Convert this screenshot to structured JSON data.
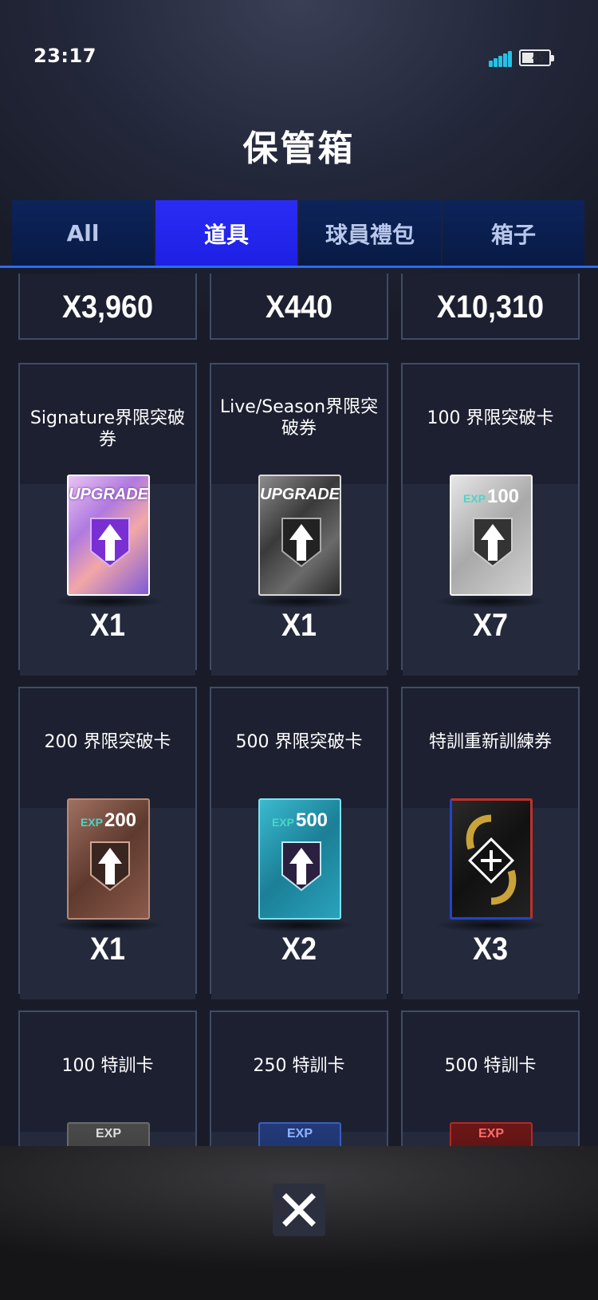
{
  "status_bar": {
    "time": "23:17",
    "battery": "45"
  },
  "page_title": "保管箱",
  "tabs": [
    {
      "label": "All",
      "active": false
    },
    {
      "label": "道具",
      "active": true
    },
    {
      "label": "球員禮包",
      "active": false
    },
    {
      "label": "箱子",
      "active": false
    }
  ],
  "items": [
    {
      "name": "",
      "qty": "X3,960"
    },
    {
      "name": "",
      "qty": "X440"
    },
    {
      "name": "",
      "qty": "X10,310"
    },
    {
      "name": "Signature界限突破券",
      "qty": "X1",
      "card_label": "UPGRADE",
      "icon": "signature-upgrade-ticket-icon"
    },
    {
      "name": "Live/Season界限突破券",
      "qty": "X1",
      "card_label": "UPGRADE",
      "icon": "live-season-upgrade-ticket-icon"
    },
    {
      "name": "100 界限突破卡",
      "qty": "X7",
      "exp_label": "EXP",
      "exp_value": "100",
      "icon": "exp-100-limit-break-card-icon"
    },
    {
      "name": "200 界限突破卡",
      "qty": "X1",
      "exp_label": "EXP",
      "exp_value": "200",
      "icon": "exp-200-limit-break-card-icon"
    },
    {
      "name": "500 界限突破卡",
      "qty": "X2",
      "exp_label": "EXP",
      "exp_value": "500",
      "icon": "exp-500-limit-break-card-icon"
    },
    {
      "name": "特訓重新訓練券",
      "qty": "X3",
      "icon": "retrain-ticket-icon"
    },
    {
      "name": "100 特訓卡",
      "exp_label": "EXP",
      "icon": "training-card-100-icon"
    },
    {
      "name": "250 特訓卡",
      "exp_label": "EXP",
      "icon": "training-card-250-icon"
    },
    {
      "name": "500 特訓卡",
      "exp_label": "EXP",
      "icon": "training-card-500-icon"
    }
  ],
  "close_icon": "close-icon",
  "colors": {
    "tab_active": "#2a2cf5",
    "tab_inactive": "#0d245a",
    "cell_border": "#3f4c66",
    "exp_accent": "#4bd6c5"
  }
}
